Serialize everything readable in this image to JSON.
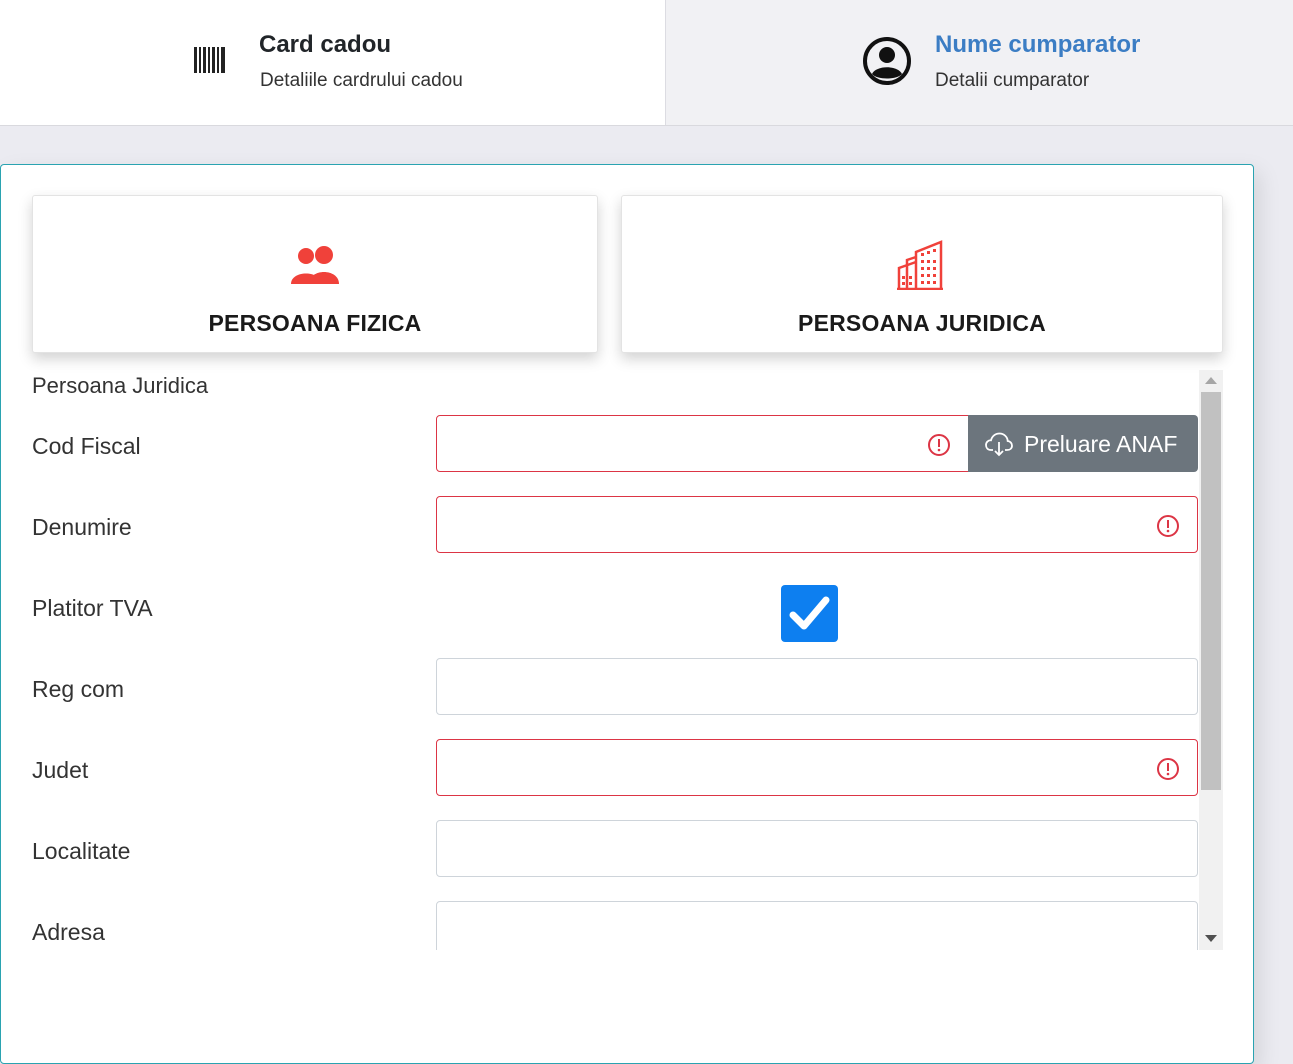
{
  "stepper": {
    "steps": [
      {
        "title": "Card cadou",
        "subtitle": "Detaliile cardrului cadou",
        "icon": "barcode-icon"
      },
      {
        "title": "Nume cumparator",
        "subtitle": "Detalii cumparator",
        "icon": "user-circle-icon",
        "title_color": "#3b7dc4"
      }
    ]
  },
  "types": {
    "fizica": {
      "label": "PERSOANA FIZICA",
      "icon": "users-icon",
      "icon_color": "#f0413a"
    },
    "juridica": {
      "label": "PERSOANA JURIDICA",
      "icon": "building-icon",
      "icon_color": "#f0413a"
    }
  },
  "form": {
    "section_title": "Persoana Juridica",
    "fields": [
      {
        "label": "Cod Fiscal",
        "value": "",
        "invalid": true
      },
      {
        "label": "Denumire",
        "value": "",
        "invalid": true
      },
      {
        "label": "Platitor TVA",
        "checked": true
      },
      {
        "label": "Reg com",
        "value": "",
        "invalid": false
      },
      {
        "label": "Judet",
        "value": "",
        "invalid": true
      },
      {
        "label": "Localitate",
        "value": "",
        "invalid": false
      },
      {
        "label": "Adresa",
        "value": "",
        "invalid": false
      }
    ],
    "anaf_button": {
      "label": "Preluare ANAF",
      "icon": "cloud-download-icon"
    }
  },
  "colors": {
    "accent": "#0d7ff0",
    "error": "#dc3545",
    "panel_border": "#2aa3b1",
    "secondary": "#6c757d"
  }
}
